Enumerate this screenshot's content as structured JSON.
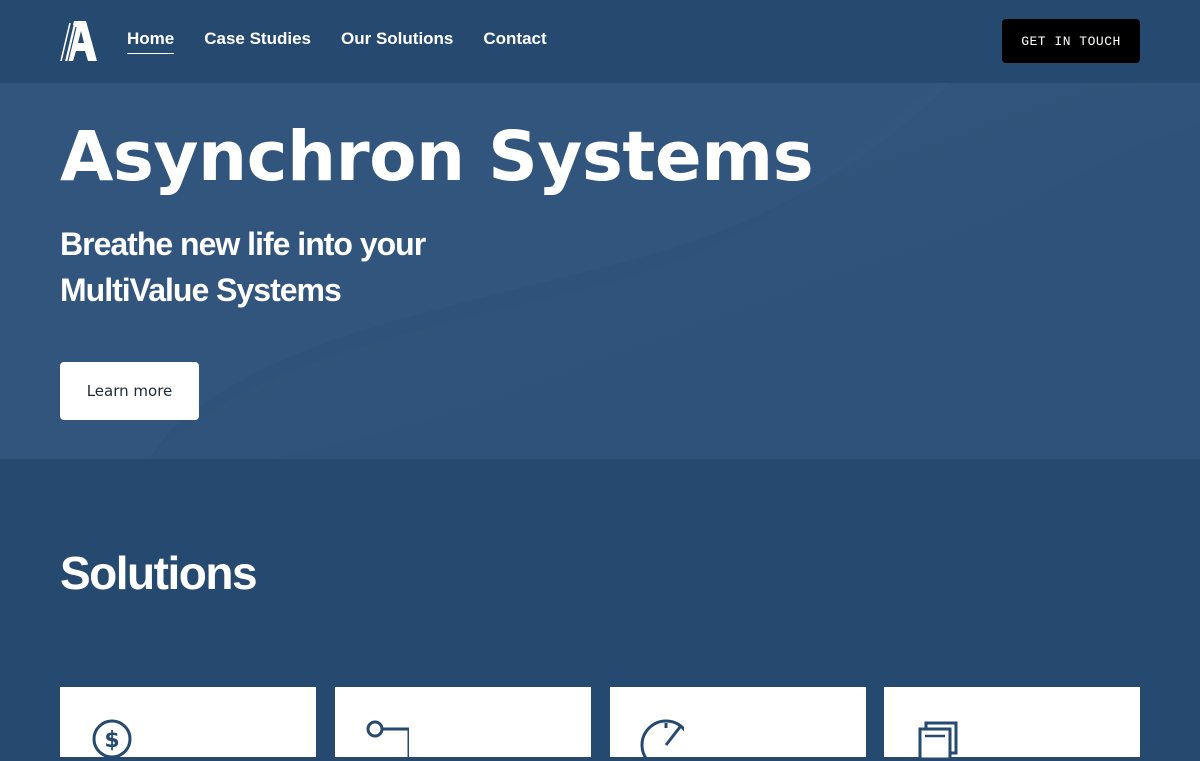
{
  "header": {
    "logo_icon": "asynchron-logo-icon",
    "nav": [
      {
        "label": "Home",
        "active": true
      },
      {
        "label": "Case Studies",
        "active": false
      },
      {
        "label": "Our Solutions",
        "active": false
      },
      {
        "label": "Contact",
        "active": false
      }
    ],
    "cta_label": "GET IN TOUCH"
  },
  "hero": {
    "title": "Asynchron Systems",
    "subtitle": "Breathe new life into your MultiValue Systems",
    "button_label": "Learn more"
  },
  "solutions": {
    "title": "Solutions",
    "cards": [
      {
        "icon": "dollar-coin-icon"
      },
      {
        "icon": "connector-node-icon"
      },
      {
        "icon": "speedometer-icon"
      },
      {
        "icon": "stacked-documents-icon"
      }
    ]
  },
  "colors": {
    "background": "#26496f",
    "hero_background": "#2e5279",
    "cta_background": "#000000",
    "icon_color": "#26496f"
  }
}
